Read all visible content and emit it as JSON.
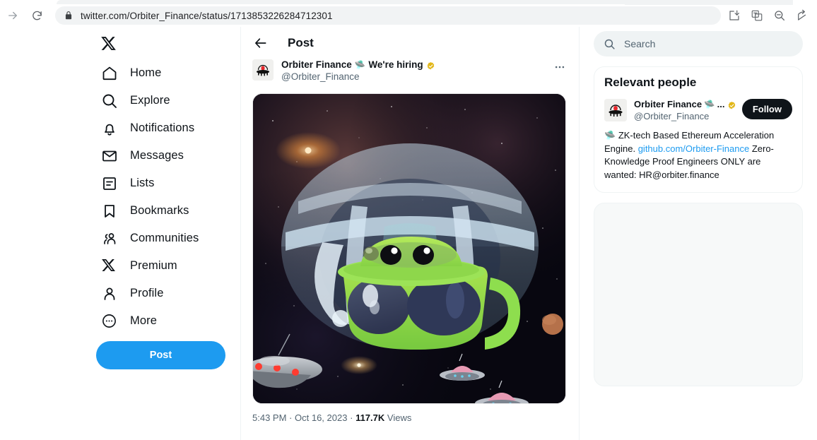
{
  "browser": {
    "url": "twitter.com/Orbiter_Finance/status/1713853226284712301",
    "icons": {
      "forward": "forward-arrow-icon",
      "reload": "reload-icon",
      "lock": "lock-icon",
      "install": "install-app-icon",
      "translate": "translate-icon",
      "zoom_out": "zoom-out-icon",
      "share": "share-icon"
    }
  },
  "sidebar": {
    "logo": "x-logo",
    "items": [
      {
        "label": "Home",
        "icon": "home-icon"
      },
      {
        "label": "Explore",
        "icon": "search-icon"
      },
      {
        "label": "Notifications",
        "icon": "bell-icon"
      },
      {
        "label": "Messages",
        "icon": "envelope-icon"
      },
      {
        "label": "Lists",
        "icon": "list-icon"
      },
      {
        "label": "Bookmarks",
        "icon": "bookmark-icon"
      },
      {
        "label": "Communities",
        "icon": "communities-icon"
      },
      {
        "label": "Premium",
        "icon": "x-icon"
      },
      {
        "label": "Profile",
        "icon": "person-icon"
      },
      {
        "label": "More",
        "icon": "more-circle-icon"
      }
    ],
    "post_button": "Post"
  },
  "main": {
    "title": "Post",
    "back": "back-arrow-icon",
    "tweet": {
      "display_name": "Orbiter Finance",
      "name_emoji": "🛸",
      "name_suffix": "We're hiring",
      "verified": "gold-verified-badge",
      "handle": "@Orbiter_Finance",
      "more": "more-options-icon",
      "media_alt": "space-illustration-green-ufo-mug",
      "time": "5:43 PM",
      "separator_1": "·",
      "date": "Oct 16, 2023",
      "separator_2": "·",
      "views_count": "117.7K",
      "views_label": "Views"
    }
  },
  "right": {
    "search": {
      "placeholder": "Search",
      "value": "",
      "icon": "search-icon"
    },
    "relevant_people": {
      "title": "Relevant people",
      "person": {
        "display_name": "Orbiter Finance",
        "name_emoji": "🛸",
        "truncation": "...",
        "verified": "gold-verified-badge",
        "handle": "@Orbiter_Finance",
        "follow_label": "Follow",
        "bio_emoji": "🛸",
        "bio_part1": "ZK-tech Based Ethereum Acceleration Engine. ",
        "bio_link": "github.com/Orbiter-Finance",
        "bio_part2": " Zero-Knowledge Proof Engineers ONLY are wanted: HR@orbiter.finance"
      }
    }
  },
  "colors": {
    "brand_blue": "#1d9bf0",
    "text_primary": "#0f1419",
    "text_secondary": "#536471",
    "border": "#eff3f4",
    "verified_gold": "#e2b719",
    "follow_bg": "#0f1419"
  }
}
